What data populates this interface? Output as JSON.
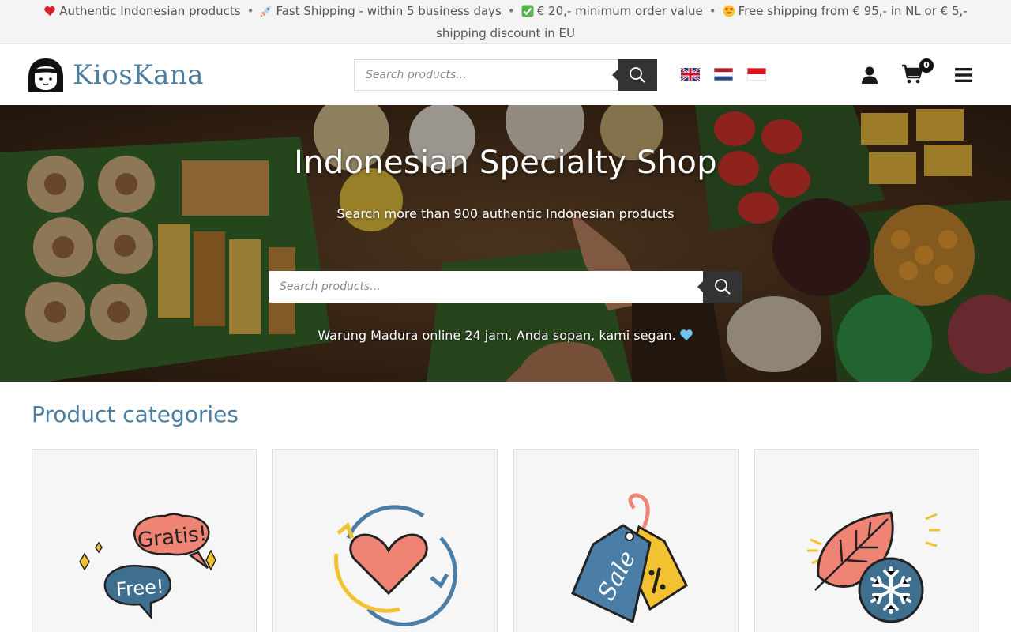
{
  "notice": {
    "items": [
      {
        "icon": "red-heart-icon",
        "text": "Authentic Indonesian products"
      },
      {
        "icon": "rocket-icon",
        "text": "Fast Shipping - within 5 business days"
      },
      {
        "icon": "check-mark-icon",
        "text": "€ 20,- minimum order value"
      },
      {
        "icon": "heart-eyes-icon",
        "text": "Free shipping from € 95,- in NL or € 5,- shipping discount in EU"
      }
    ],
    "separator": "•"
  },
  "header": {
    "logo_text": "KiosKana",
    "search_placeholder": "Search products...",
    "languages": [
      {
        "icon": "uk-flag-icon"
      },
      {
        "icon": "netherlands-flag-icon"
      },
      {
        "icon": "indonesia-flag-icon"
      }
    ],
    "cart_count": "0"
  },
  "hero": {
    "title": "Indonesian Specialty Shop",
    "subtitle": "Search more than 900 authentic Indonesian products",
    "search_placeholder": "Search products...",
    "tagline": "Warung Madura online 24 jam. Anda sopan, kami segan."
  },
  "categories": {
    "heading": "Product categories",
    "items": [
      {
        "icon": "free-gratis-speech-bubbles-icon"
      },
      {
        "icon": "heart-refresh-icon"
      },
      {
        "icon": "sale-tags-icon"
      },
      {
        "icon": "leaf-snowflake-icon"
      }
    ]
  },
  "colors": {
    "brand": "#4b7ea0",
    "search_button": "#333333",
    "notice_bg": "#f4f4f4"
  }
}
